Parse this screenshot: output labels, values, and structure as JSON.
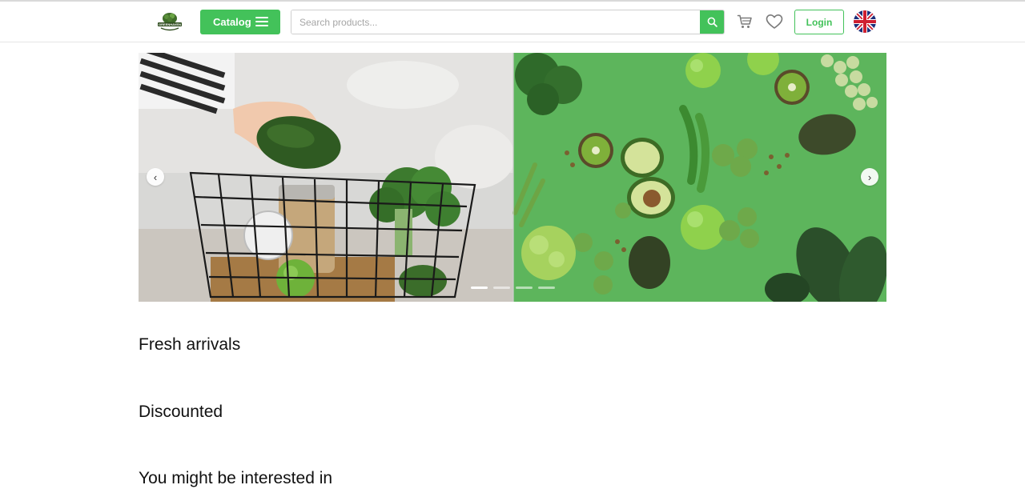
{
  "header": {
    "logo_text": "GREENHAVEN",
    "catalog_label": "Catalog",
    "search_placeholder": "Search products...",
    "login_label": "Login"
  },
  "icons": {
    "menu": "menu-icon",
    "search": "search-icon",
    "cart": "cart-icon",
    "wishlist": "heart-icon",
    "language": "uk-flag-icon",
    "prev": "chevron-left-icon",
    "next": "chevron-right-icon"
  },
  "carousel": {
    "prev_glyph": "‹",
    "next_glyph": "›",
    "slide_count": 4,
    "active_index": 0
  },
  "sections": [
    {
      "title": "Fresh arrivals"
    },
    {
      "title": "Discounted"
    },
    {
      "title": "You might be interested in"
    }
  ],
  "colors": {
    "accent": "#43c25a",
    "header_border": "#e6e6e6"
  }
}
